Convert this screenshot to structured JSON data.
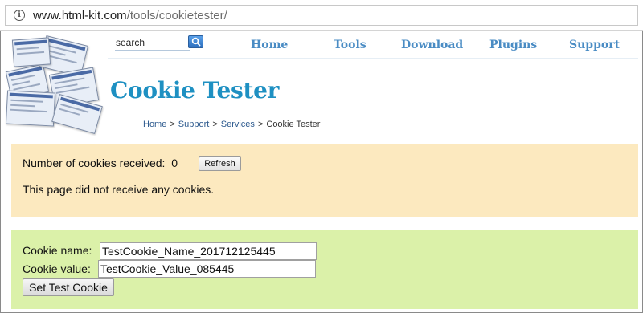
{
  "browser": {
    "url_host": "www.html-kit.com",
    "url_path": "/tools/cookietester/"
  },
  "header": {
    "search_placeholder": "search",
    "nav": [
      "Home",
      "Tools",
      "Download",
      "Plugins",
      "Support"
    ]
  },
  "page": {
    "title": "Cookie Tester",
    "breadcrumb": [
      "Home",
      "Support",
      "Services",
      "Cookie Tester"
    ]
  },
  "received": {
    "count_label": "Number of cookies received:",
    "count": "0",
    "refresh_label": "Refresh",
    "message": "This page did not receive any cookies."
  },
  "form": {
    "name_label": "Cookie name:",
    "name_value": "TestCookie_Name_201712125445",
    "value_label": "Cookie value:",
    "value_value": "TestCookie_Value_085445",
    "submit_label": "Set Test Cookie"
  },
  "colors": {
    "accent": "#1e90c2",
    "nav": "#4a8cc4",
    "info_panel": "#fce9bf",
    "form_panel": "#dbf1a9"
  },
  "icons": {
    "address_bar": "info-icon",
    "search_button": "search-icon"
  }
}
